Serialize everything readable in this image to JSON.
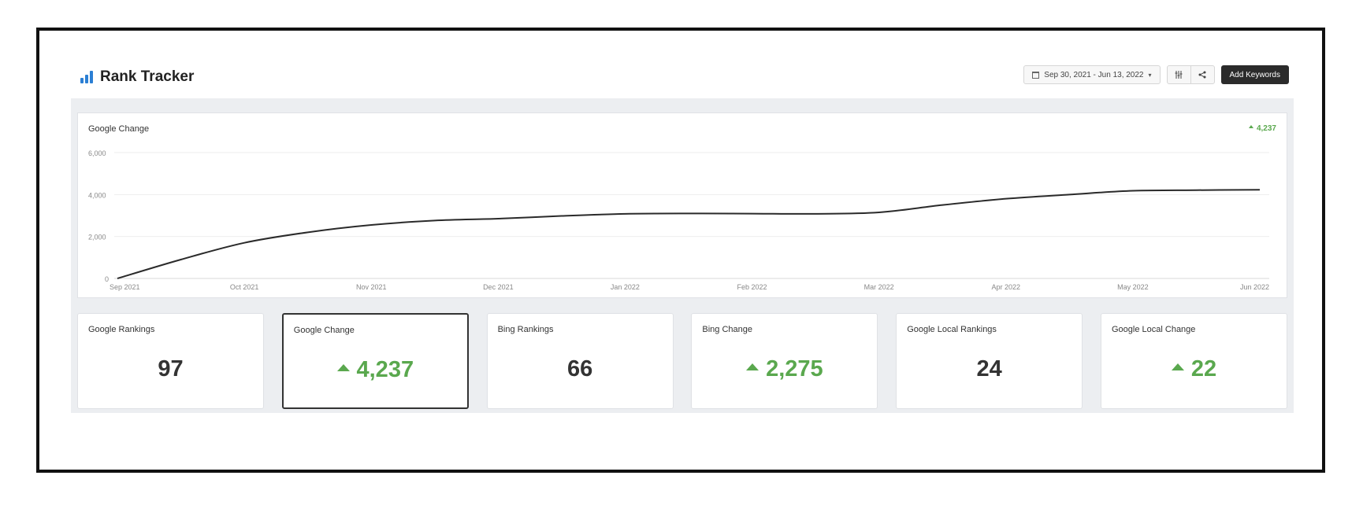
{
  "header": {
    "title": "Rank Tracker",
    "date_range": "Sep 30, 2021 - Jun 13, 2022",
    "add_keywords_label": "Add Keywords"
  },
  "chart": {
    "title": "Google Change",
    "change_value": "4,237"
  },
  "chart_data": {
    "type": "line",
    "title": "Google Change",
    "x": [
      "Sep 2021",
      "Oct 2021",
      "Nov 2021",
      "Dec 2021",
      "Jan 2022",
      "Feb 2022",
      "Mar 2022",
      "Apr 2022",
      "May 2022",
      "Jun 2022"
    ],
    "x_positions": [
      0,
      1,
      2,
      3,
      4,
      5,
      6,
      7,
      8,
      9
    ],
    "series": [
      {
        "points": [
          [
            0,
            0
          ],
          [
            0.5,
            900
          ],
          [
            1,
            1700
          ],
          [
            1.5,
            2200
          ],
          [
            2,
            2550
          ],
          [
            2.5,
            2760
          ],
          [
            3,
            2850
          ],
          [
            3.5,
            2980
          ],
          [
            4,
            3080
          ],
          [
            4.5,
            3100
          ],
          [
            5,
            3090
          ],
          [
            5.5,
            3080
          ],
          [
            6,
            3150
          ],
          [
            6.5,
            3500
          ],
          [
            7,
            3800
          ],
          [
            7.5,
            4000
          ],
          [
            8,
            4180
          ],
          [
            8.5,
            4210
          ],
          [
            9,
            4230
          ]
        ]
      }
    ],
    "yticks": [
      "0",
      "2,000",
      "4,000",
      "6,000"
    ],
    "ylim": [
      0,
      6000
    ],
    "xlabel": "",
    "ylabel": "",
    "grid": true,
    "legend": "none"
  },
  "tiles": [
    {
      "label": "Google Rankings",
      "value": "97",
      "trend": "none",
      "active": false
    },
    {
      "label": "Google Change",
      "value": "4,237",
      "trend": "up",
      "active": true
    },
    {
      "label": "Bing Rankings",
      "value": "66",
      "trend": "none",
      "active": false
    },
    {
      "label": "Bing Change",
      "value": "2,275",
      "trend": "up",
      "active": false
    },
    {
      "label": "Google Local Rankings",
      "value": "24",
      "trend": "none",
      "active": false
    },
    {
      "label": "Google Local Change",
      "value": "22",
      "trend": "up",
      "active": false
    }
  ],
  "colors": {
    "accent": "#2b7fd4",
    "positive": "#5aa84e",
    "line": "#2a2a2a",
    "panel_bg": "#eceef1"
  },
  "icons": [
    "bar-chart-icon",
    "calendar-icon",
    "caret-down-icon",
    "columns-icon",
    "share-icon",
    "up-triangle-icon"
  ]
}
